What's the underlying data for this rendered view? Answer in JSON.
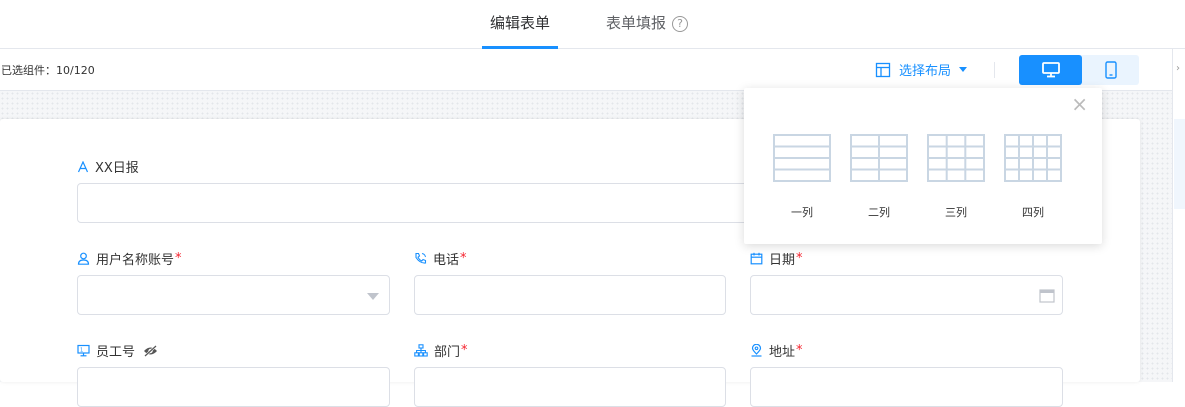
{
  "tabs": {
    "edit_label": "编辑表单",
    "fill_label": "表单填报",
    "help": "?"
  },
  "toolbar": {
    "selected_count": "已选组件：10/120",
    "layout_label": "选择布局"
  },
  "colors": {
    "primary": "#1890ff",
    "required": "#f5222d",
    "border": "#dcdfe6"
  },
  "form": {
    "report_title": {
      "label": "XX日报",
      "icon": "text-icon"
    },
    "username": {
      "label": "用户名称账号",
      "required": "*",
      "icon": "user-icon"
    },
    "phone": {
      "label": "电话",
      "required": "*",
      "icon": "phone-icon"
    },
    "date": {
      "label": "日期",
      "required": "*",
      "icon": "calendar-icon"
    },
    "employee_no": {
      "label": "员工号",
      "icon": "monitor-icon",
      "visibility_icon": "eye-slash-icon"
    },
    "department": {
      "label": "部门",
      "required": "*",
      "icon": "org-chart-icon"
    },
    "address": {
      "label": "地址",
      "required": "*",
      "icon": "location-icon"
    }
  },
  "layout_popover": {
    "close": "×",
    "options": [
      {
        "label": "一列",
        "columns": 1
      },
      {
        "label": "二列",
        "columns": 2
      },
      {
        "label": "三列",
        "columns": 3
      },
      {
        "label": "四列",
        "columns": 4
      }
    ]
  }
}
